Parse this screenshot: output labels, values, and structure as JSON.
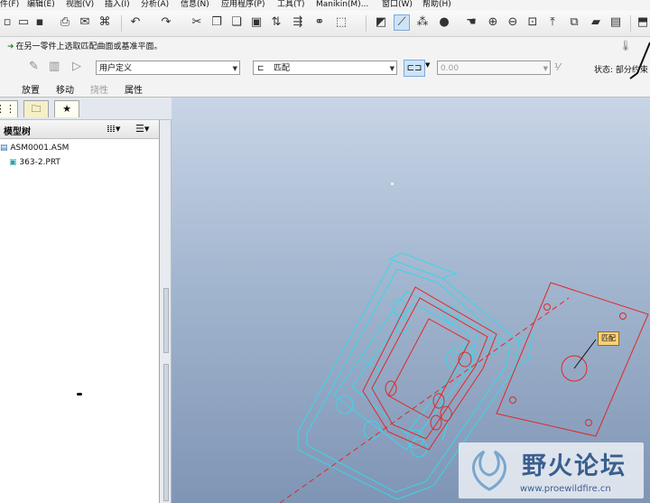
{
  "menu": [
    "件(F)",
    "编辑(E)",
    "视图(V)",
    "插入(I)",
    "分析(A)",
    "信息(N)",
    "应用程序(P)",
    "工具(T)",
    "Manikin(M)...",
    "窗口(W)",
    "帮助(H)"
  ],
  "dashboard": {
    "prompt": "在另一零件上选取匹配曲面或基准平面。",
    "constraint_set": "用户定义",
    "constraint_type": "匹配",
    "offset_value": "0.00",
    "status": "状态: 部分约束",
    "tabs": {
      "placement": "放置",
      "move": "移动",
      "flexibility": "挠性",
      "properties": "属性"
    }
  },
  "model_tree": {
    "title": "模型树",
    "items": [
      {
        "label": "ASM0001.ASM"
      },
      {
        "label": "363-2.PRT"
      }
    ]
  },
  "viewport": {
    "tag_label": "匹配",
    "background_top": "#c8d5e6",
    "background_bottom": "#7f95b5",
    "cyan_color": "#37d7ea",
    "red_color": "#e02828"
  },
  "watermark": {
    "name": "野火论坛",
    "url": "www.proewildfire.cn"
  }
}
